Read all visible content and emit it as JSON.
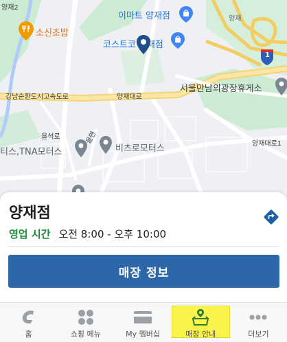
{
  "map": {
    "labels": {
      "yangjae_gu": "양재2",
      "emart": "이마트 양재점",
      "costco": "코스트코 양재점",
      "sosin": "소신초밥",
      "expressway": "강남순환도시고속도로",
      "yangjae_daero": "양재대로",
      "seoul_rest": "서울만남의광장휴게소",
      "yangjae_daero_1": "양재대로1",
      "ulsanro": "을석로",
      "tna": "티스,TNA모터스",
      "vichro": "비츠로모터스",
      "ulmyeon": "을면",
      "highway_no": "1",
      "top_right": "양재"
    }
  },
  "store": {
    "name": "양재점",
    "hours_label": "영업 시간",
    "hours_value": "오전 8:00 - 오후 10:00",
    "info_button": "매장 정보"
  },
  "nav": {
    "items": [
      {
        "label": "홈",
        "icon": "costco-logo-icon"
      },
      {
        "label": "쇼핑 메뉴",
        "icon": "grid-dots-icon"
      },
      {
        "label": "My 멤버십",
        "icon": "membership-card-icon"
      },
      {
        "label": "매장 안내",
        "icon": "store-location-icon"
      },
      {
        "label": "더보기",
        "icon": "more-dots-icon"
      }
    ],
    "active_index": 3
  },
  "colors": {
    "accent_blue": "#2b67a9",
    "hours_green": "#1e8a3c",
    "active_nav_yellow": "#fbf24a",
    "directions_blue": "#1f5fa8"
  }
}
